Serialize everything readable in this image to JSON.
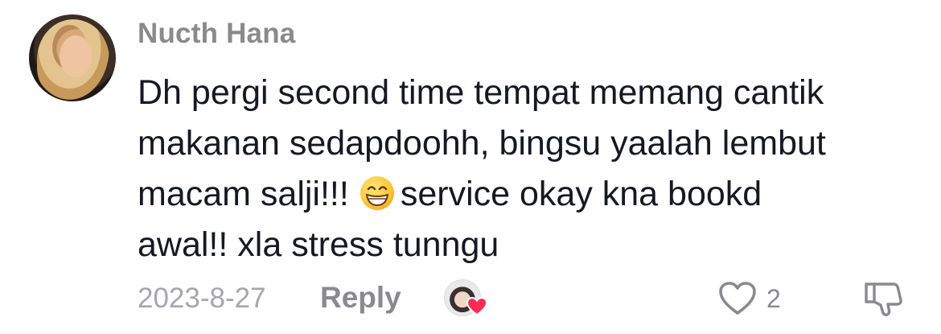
{
  "comment": {
    "avatar_icon": "user-avatar-icon",
    "username": "Nucth Hana",
    "text_lines": [
      "Dh pergi second time tempat memang cantik",
      "makanan sedapdoohh, bingsu yaalah lembut",
      "macam salji!!!",
      "service okay kna bookd",
      "awal!! xla stress tunngu"
    ],
    "emoji_icon": "grinning-face-emoji",
    "date": "2023-8-27",
    "reply_label": "Reply",
    "creator_liked_icon": "creator-liked-avatar-icon",
    "like_icon": "heart-outline-icon",
    "like_count": "2",
    "dislike_icon": "thumbs-down-outline-icon",
    "colors": {
      "text": "#161823",
      "muted": "#8a8a8e",
      "heart_red": "#fe2c55"
    }
  }
}
